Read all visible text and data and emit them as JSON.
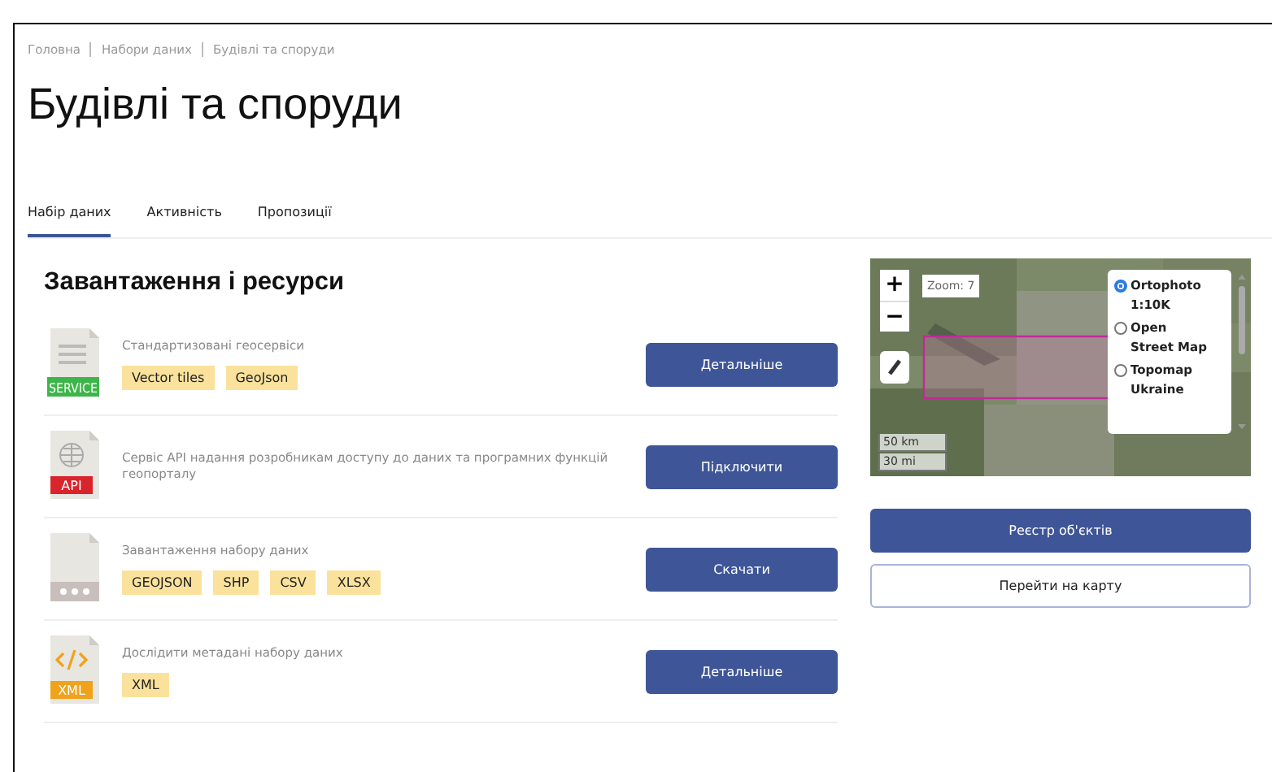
{
  "breadcrumbs": [
    "Головна",
    "Набори даних",
    "Будівлі та споруди"
  ],
  "title": "Будівлі та споруди",
  "tabs": [
    {
      "label": "Набір даних",
      "selected": true
    },
    {
      "label": "Активність",
      "selected": false
    },
    {
      "label": "Пропозиції",
      "selected": false
    }
  ],
  "section_title": "Завантаження і ресурси",
  "resources": [
    {
      "kind": "service",
      "icon_label": "SERVICE",
      "description": "Стандартизовані геосервіси",
      "tags": [
        "Vector tiles",
        "GeoJson"
      ],
      "button": "Детальніше"
    },
    {
      "kind": "api",
      "icon_label": "API",
      "description": "Сервіс API надання розробникам доступу до даних та програмних функцій геопорталу",
      "button": "Підключити"
    },
    {
      "kind": "file",
      "description": "Завантаження набору даних",
      "tags": [
        "GEOJSON",
        "SHP",
        "CSV",
        "XLSX"
      ],
      "button": "Скачати"
    },
    {
      "kind": "xml",
      "icon_label": "XML",
      "description": "Дослідити метадані набору даних",
      "tags": [
        "XML"
      ],
      "button": "Детальніше"
    }
  ],
  "map": {
    "zoom_in": "+",
    "zoom_out": "−",
    "zoom_label": "Zoom: 7",
    "layers": [
      {
        "label": "Ortophoto 1:10K",
        "selected": true
      },
      {
        "label": "Open Street Map",
        "selected": false
      },
      {
        "label": "Topomap Ukraine",
        "selected": false
      }
    ],
    "scale": [
      "50 km",
      "30 mi"
    ]
  },
  "buttons": [
    {
      "label": "Реєстр об'єктів",
      "kind": "primary"
    },
    {
      "label": "Перейти на карту",
      "kind": "outline"
    }
  ]
}
